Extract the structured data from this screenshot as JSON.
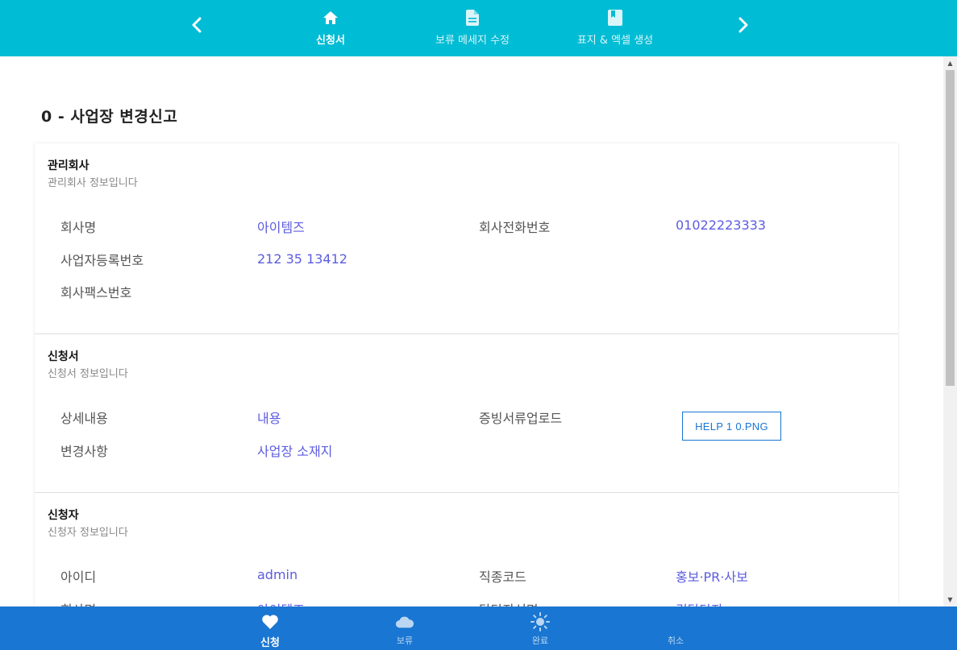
{
  "top_nav": {
    "prev_icon": "chevron-left-icon",
    "next_icon": "chevron-right-icon",
    "tabs": [
      {
        "label": "신청서",
        "icon": "home-icon",
        "active": true
      },
      {
        "label": "보류 메세지 수정",
        "icon": "document-icon",
        "active": false
      },
      {
        "label": "표지 & 엑셀 생성",
        "icon": "book-icon",
        "active": false
      }
    ]
  },
  "page_title": "0 - 사업장 변경신고",
  "sections": {
    "company": {
      "title": "관리회사",
      "subtitle": "관리회사 정보입니다",
      "fields": {
        "name_label": "회사명",
        "name_value": "아이템즈",
        "phone_label": "회사전화번호",
        "phone_value": "01022223333",
        "reg_label": "사업자등록번호",
        "reg_value": "212 35 13412",
        "fax_label": "회사팩스번호",
        "fax_value": ""
      }
    },
    "application": {
      "title": "신청서",
      "subtitle": "신청서 정보입니다",
      "fields": {
        "detail_label": "상세내용",
        "detail_value": "내용",
        "upload_label": "증빙서류업로드",
        "upload_button": "HELP 1 0.PNG",
        "change_label": "변경사항",
        "change_value": "사업장 소재지"
      }
    },
    "applicant": {
      "title": "신청자",
      "subtitle": "신청자 정보입니다",
      "fields": {
        "id_label": "아이디",
        "id_value": "admin",
        "job_label": "직종코드",
        "job_value": "홍보·PR·사보",
        "company_label": "회사명",
        "company_value": "아이템즈",
        "manager_label": "담당자성명",
        "manager_value": "김담당자"
      }
    }
  },
  "bottom_nav": [
    {
      "label": "신청",
      "icon": "heart-icon",
      "active": true
    },
    {
      "label": "보류",
      "icon": "cloud-icon",
      "active": false
    },
    {
      "label": "완료",
      "icon": "sun-icon",
      "active": false
    },
    {
      "label": "취소",
      "icon": "moon-icon",
      "active": false
    }
  ],
  "colors": {
    "top_bar": "#00bcd4",
    "bottom_bar": "#1976d2",
    "value_text": "#5c5ce0",
    "button_border": "#1976d2"
  }
}
